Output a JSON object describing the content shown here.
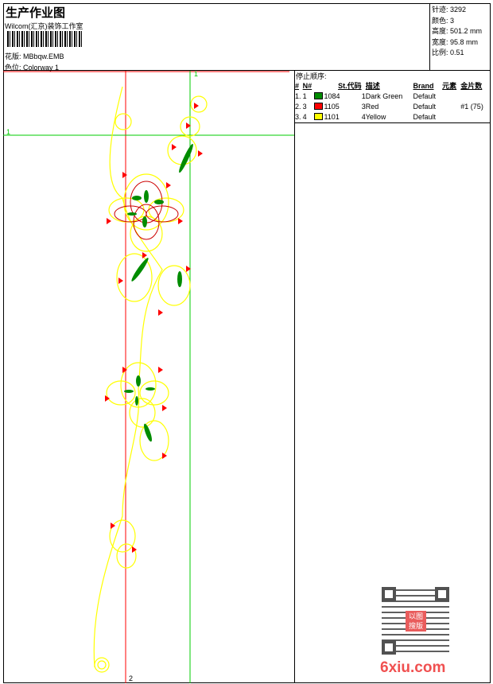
{
  "header": {
    "title": "生产作业图",
    "company": "Wilcom(汇京)装饰工作室",
    "design_label": "花版:",
    "design_value": "MBbqw.EMB",
    "colorway_label": "色位:",
    "colorway_value": "Colorway 1"
  },
  "info": [
    {
      "label": "针迹:",
      "value": "3292"
    },
    {
      "label": "颜色:",
      "value": "3"
    },
    {
      "label": "高度:",
      "value": "501.2 mm"
    },
    {
      "label": "宽度:",
      "value": "95.8 mm"
    },
    {
      "label": "比例:",
      "value": "0.51"
    }
  ],
  "canvas": {
    "marker_1_top": "1",
    "marker_1_left": "1",
    "marker_2": "2"
  },
  "stop_sequence": {
    "heading": "停止顺序:",
    "columns": [
      "#",
      "N#",
      "St.",
      "代码",
      "描述",
      "Brand",
      "元素",
      "金片数"
    ],
    "rows": [
      {
        "idx": "1.",
        "n": "1",
        "color": "#008c00",
        "st": "1084",
        "code": "1",
        "desc": "Dark Green",
        "brand": "Default",
        "elem": "",
        "sequin": ""
      },
      {
        "idx": "2.",
        "n": "3",
        "color": "#ff0000",
        "st": "1105",
        "code": "3",
        "desc": "Red",
        "brand": "Default",
        "elem": "",
        "sequin": "#1 (75)"
      },
      {
        "idx": "3.",
        "n": "4",
        "color": "#ffff00",
        "st": "1101",
        "code": "4",
        "desc": "Yellow",
        "brand": "Default",
        "elem": "",
        "sequin": ""
      }
    ]
  },
  "watermark": {
    "logo_text": "以图搜版",
    "site": "6xiu.com"
  }
}
